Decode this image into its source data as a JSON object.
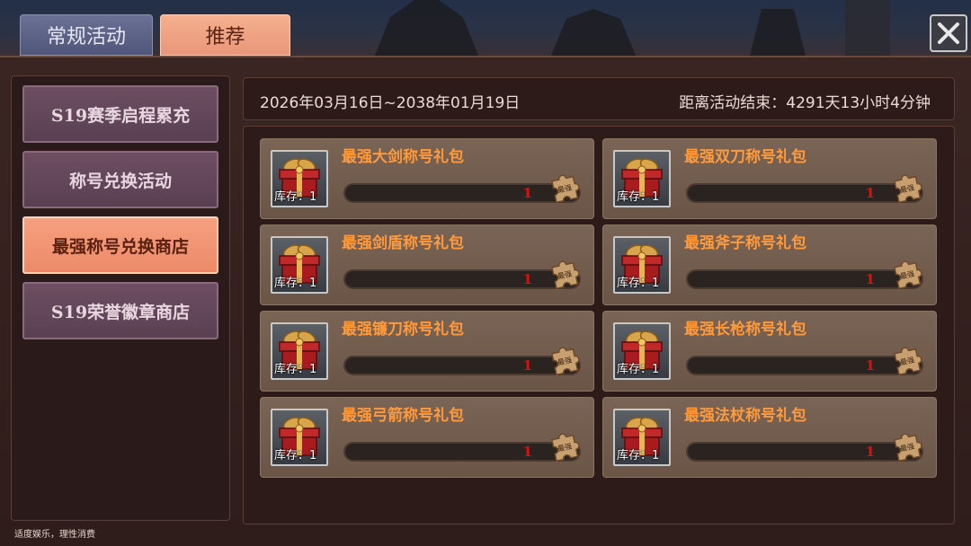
{
  "tabs": {
    "regular_label": "常规活动",
    "recommend_label": "推荐"
  },
  "sidebar": {
    "items": [
      {
        "label": "S19赛季启程累充",
        "active": false
      },
      {
        "label": "称号兑换活动",
        "active": false
      },
      {
        "label": "最强称号兑换商店",
        "active": true
      },
      {
        "label": "S19荣誉徽章商店",
        "active": false
      }
    ],
    "footer": "适度娱乐，理性消费"
  },
  "event": {
    "date_range": "2026年03月16日~2038年01月19日",
    "countdown": "距离活动结束：4291天13小时4分钟"
  },
  "shop": {
    "items": [
      {
        "title": "最强大剑称号礼包",
        "stock": "库存：1",
        "count": "1"
      },
      {
        "title": "最强双刀称号礼包",
        "stock": "库存：1",
        "count": "1"
      },
      {
        "title": "最强剑盾称号礼包",
        "stock": "库存：1",
        "count": "1"
      },
      {
        "title": "最强斧子称号礼包",
        "stock": "库存：1",
        "count": "1"
      },
      {
        "title": "最强镰刀称号礼包",
        "stock": "库存：1",
        "count": "1"
      },
      {
        "title": "最强长枪称号礼包",
        "stock": "库存：1",
        "count": "1"
      },
      {
        "title": "最强弓箭称号礼包",
        "stock": "库存：1",
        "count": "1"
      },
      {
        "title": "最强法杖称号礼包",
        "stock": "库存：1",
        "count": "1"
      }
    ],
    "badge_label": "最强"
  },
  "icons": {
    "close": "close-icon",
    "gift": "gift-box-icon",
    "badge": "puzzle-badge-icon"
  },
  "colors": {
    "active_tab": "#e9967a",
    "inactive_tab": "#50567a",
    "title_orange": "#ff9a3c",
    "count_red": "#e01010"
  }
}
